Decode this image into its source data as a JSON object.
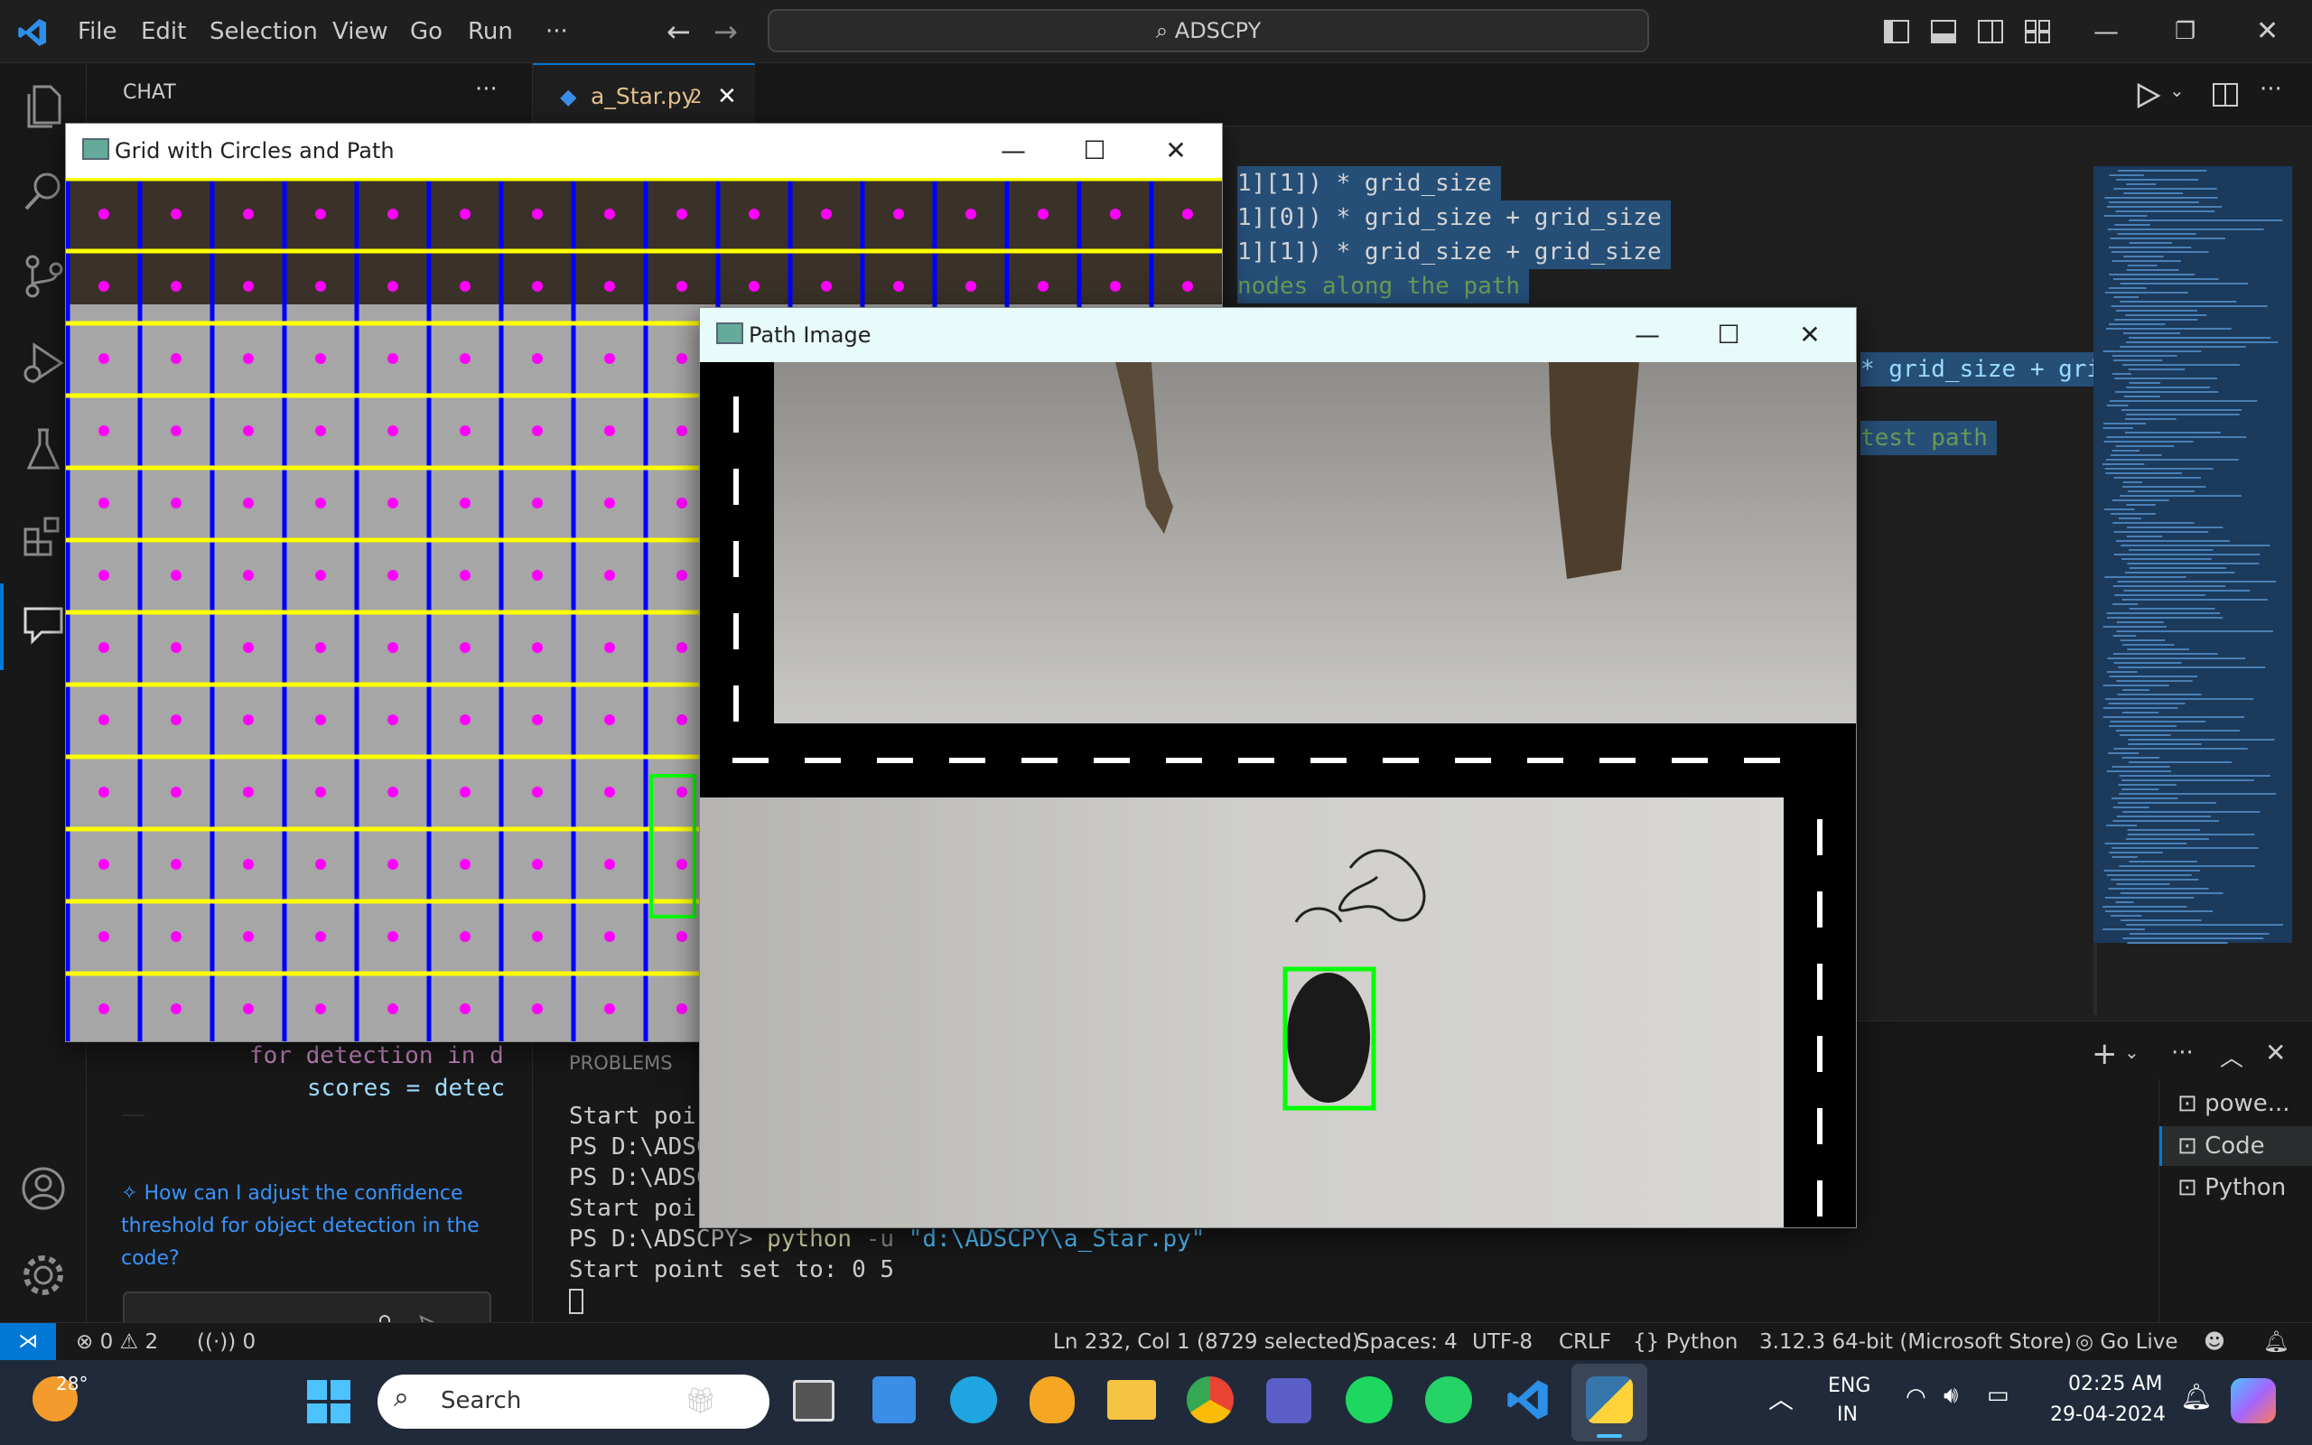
{
  "app": {
    "search_text": "ADSCPY",
    "menu": [
      "File",
      "Edit",
      "Selection",
      "View",
      "Go",
      "Run",
      "···"
    ]
  },
  "sidebar": {
    "title": "CHAT",
    "more": "···",
    "code_lines": [
      "for detection in d",
      "scores = detec"
    ],
    "suggestion": "How can I adjust the confidence threshold for object detection in the code?"
  },
  "editor": {
    "tab_label": "a_Star.py",
    "tab_badge": "2",
    "lines": [
      {
        "text": "1][0]) * grid_size"
      },
      {
        "text": "1][1]) * grid_size"
      },
      {
        "text": "1][0]) * grid_size + grid_size"
      },
      {
        "text": "1][1]) * grid_size + grid_size"
      },
      {
        "text": "nodes along the path"
      }
    ],
    "right_line1": "* grid_size + gri",
    "right_line2": "test path"
  },
  "panel": {
    "tab": "PROBLEMS",
    "terminal": [
      "Start poir",
      "PS D:\\ADSC",
      "PS D:\\ADSC",
      "Start poir",
      "PS D:\\ADSCPY> python -u \"d:\\ADSCPY\\a_Star.py\"",
      "Start point set to: 0 5"
    ],
    "cmd_prompt": "PS D:\\ADSCPY> ",
    "cmd_exe": "python",
    "cmd_flag": " -u ",
    "cmd_arg": "\"d:\\ADSCPY\\a_Star.py\"",
    "terminals": [
      "powe...",
      "Code",
      "Python"
    ]
  },
  "window_grid": {
    "title": "Grid with Circles and Path",
    "colors": {
      "grid": "#ffff00",
      "vlines": "#0000ff",
      "dots": "#ff00ff"
    }
  },
  "window_path": {
    "title": "Path Image"
  },
  "status": {
    "errors": "0",
    "warnings": "2",
    "ports": "0",
    "position": "Ln 232, Col 1 (8729 selected)",
    "spaces": "Spaces: 4",
    "encoding": "UTF-8",
    "eol": "CRLF",
    "language": "Python",
    "interpreter": "3.12.3 64-bit (Microsoft Store)",
    "golive": "Go Live"
  },
  "taskbar": {
    "weather": "28°",
    "search": "Search",
    "lang1": "ENG",
    "lang2": "IN",
    "time": "02:25 AM",
    "date": "29-04-2024"
  }
}
